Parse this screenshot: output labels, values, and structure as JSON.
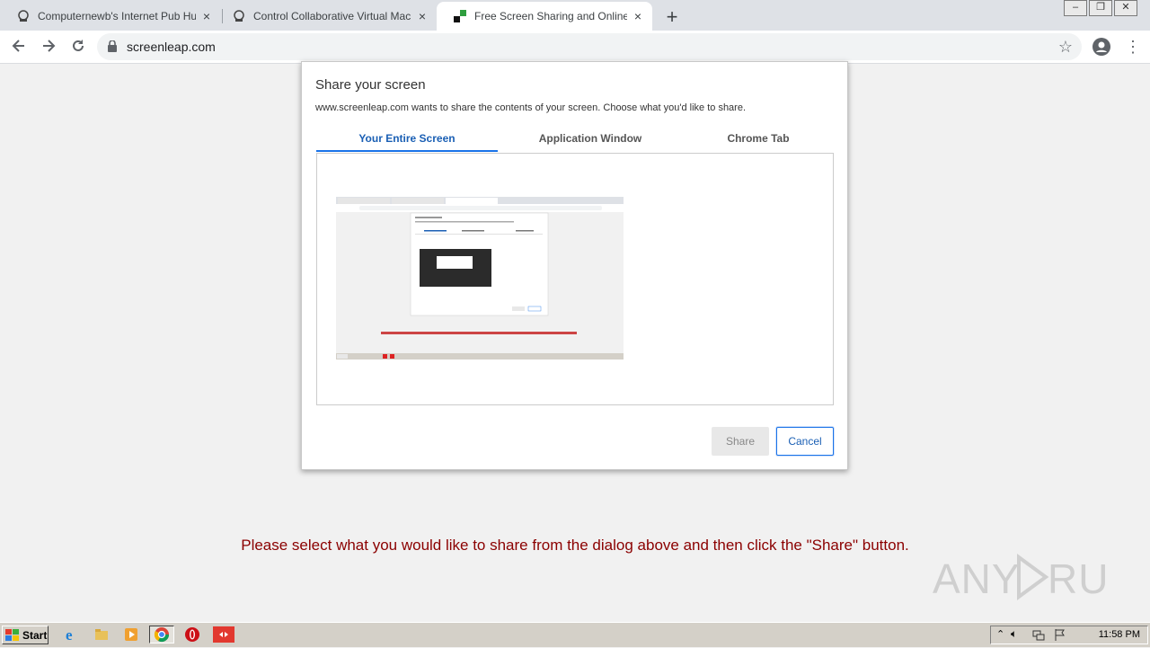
{
  "browser": {
    "tabs": [
      {
        "title": "Computernewb's Internet Pub Hub",
        "close": "×"
      },
      {
        "title": "Control Collaborative Virtual Machine",
        "close": "×"
      },
      {
        "title": "Free Screen Sharing and Online Meetings",
        "close": "×"
      }
    ],
    "new_tab": "+",
    "url": "screenleap.com"
  },
  "dialog": {
    "title": "Share your screen",
    "subtitle": "www.screenleap.com wants to share the contents of your screen. Choose what you'd like to share.",
    "tabs": [
      "Your Entire Screen",
      "Application Window",
      "Chrome Tab"
    ],
    "active_tab": 0,
    "share_label": "Share",
    "cancel_label": "Cancel"
  },
  "page": {
    "instruction": "Please select what you would like to share from the dialog above and then click the \"Share\" button.",
    "watermark": "ANY RUN"
  },
  "taskbar": {
    "start_label": "Start",
    "clock": "11:58 PM"
  },
  "colors": {
    "accent": "#1a73e8",
    "instruction": "#8b0000"
  }
}
